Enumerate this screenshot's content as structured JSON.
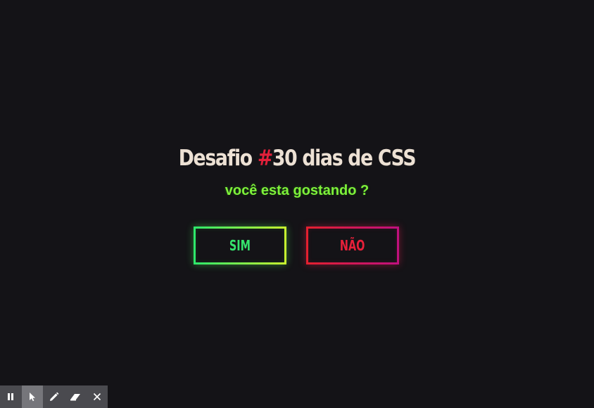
{
  "title": {
    "before": "Desafio ",
    "hash": "#",
    "after": "30 dias de CSS"
  },
  "subtitle": "você esta gostando ?",
  "buttons": {
    "yes_label": "SIM",
    "no_label": "NÃO"
  },
  "colors": {
    "background": "#141317",
    "title": "#ede1d4",
    "hash": "#e3203a",
    "subtitle": "#7ef13a",
    "yes": "#35e36c",
    "no": "#e8203a",
    "toolbar": "#4a4a4f"
  },
  "toolbar": {
    "items": [
      {
        "icon": "pause-icon",
        "active": false
      },
      {
        "icon": "cursor-icon",
        "active": true
      },
      {
        "icon": "pen-icon",
        "active": false
      },
      {
        "icon": "eraser-icon",
        "active": false
      },
      {
        "icon": "close-icon",
        "active": false
      }
    ]
  }
}
